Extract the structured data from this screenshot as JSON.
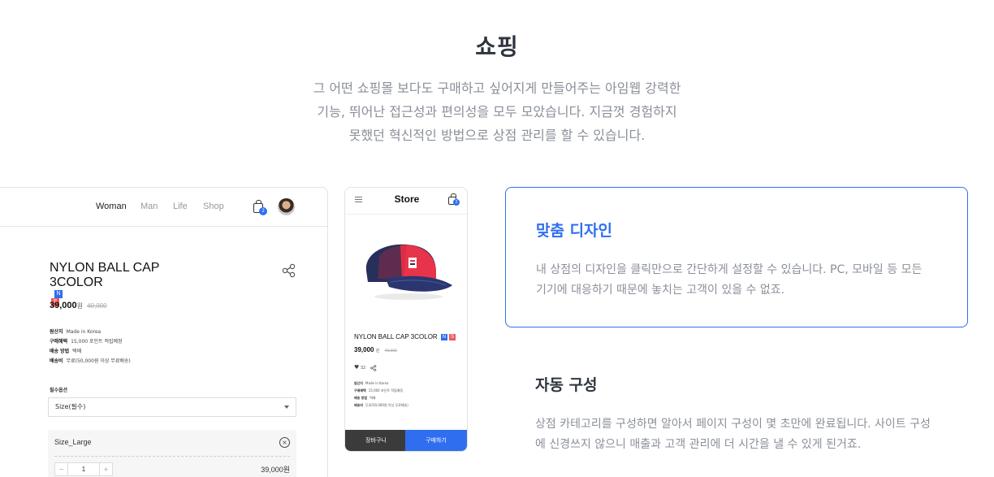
{
  "section": {
    "title": "쇼핑",
    "description_lines": [
      "그 어떤 쇼핑몰 보다도 구매하고 싶어지게 만들어주는 아임웹 강력한",
      "기능, 뛰어난 접근성과 편의성을 모두 모았습니다. 지금껏 경험하지",
      "못했던 혁신적인 방법으로 상점 관리를 할 수 있습니다."
    ]
  },
  "desktop_mockup": {
    "nav": [
      "Woman",
      "Man",
      "Life",
      "Shop"
    ],
    "active_nav": "Woman",
    "cart_count": "2",
    "product": {
      "title_lines": [
        "NYLON BALL CAP",
        "3COLOR"
      ],
      "tags": [
        "N",
        "S"
      ],
      "price": "39,000",
      "price_unit": "원",
      "old_price": "40,000",
      "info": [
        {
          "label": "원산지",
          "value": "Made in Korea"
        },
        {
          "label": "구매혜택",
          "value": "15,000 포인트 적립예정"
        },
        {
          "label": "배송 방법",
          "value": "택배"
        },
        {
          "label": "배송비",
          "value": "무료(50,000원 이상 무료배송)"
        }
      ],
      "option_label": "필수옵션",
      "select_value": "Size(필수)",
      "selected_option": "Size_Large",
      "quantity": "1",
      "minus": "−",
      "plus": "+",
      "remove": "×",
      "option_price": "39,000원"
    }
  },
  "mobile_mockup": {
    "title": "Store",
    "cart_count": "2",
    "product_name": "NYLON BALL CAP 3COLOR",
    "tags": [
      "N",
      "S"
    ],
    "price": "39,000",
    "price_unit": "원",
    "old_price": "40,000",
    "likes": "32",
    "info": [
      {
        "label": "원산지",
        "value": "Made in Korea"
      },
      {
        "label": "구매혜택",
        "value": "15,000 포인트 적립예정"
      },
      {
        "label": "배송 방법",
        "value": "택배"
      },
      {
        "label": "배송비",
        "value": "무료(50,000원 이상 무료배송)"
      }
    ],
    "cart_button": "장바구니",
    "buy_button": "구매하기"
  },
  "features": [
    {
      "title": "맞춤 디자인",
      "desc": "내 상점의 디자인을 클릭만으로 간단하게 설정할 수 있습니다. PC, 모바일 등 모든 기기에 대응하기 때문에 놓치는 고객이 있을 수 없죠.",
      "active": true
    },
    {
      "title": "자동 구성",
      "desc": "상점 카테고리를 구성하면 알아서 페이지 구성이 몇 초만에 완료됩니다. 사이트 구성에 신경쓰지 않으니 매출과 고객 관리에 더 시간을 낼 수 있게 된거죠.",
      "active": false
    }
  ],
  "colors": {
    "accent": "#2f6fef",
    "title": "#2f3440",
    "muted": "#8a8f99",
    "tag_n": "#2f6fef",
    "tag_s": "#ef5a5a",
    "cap_red": "#e8344a",
    "cap_navy": "#27305a"
  }
}
